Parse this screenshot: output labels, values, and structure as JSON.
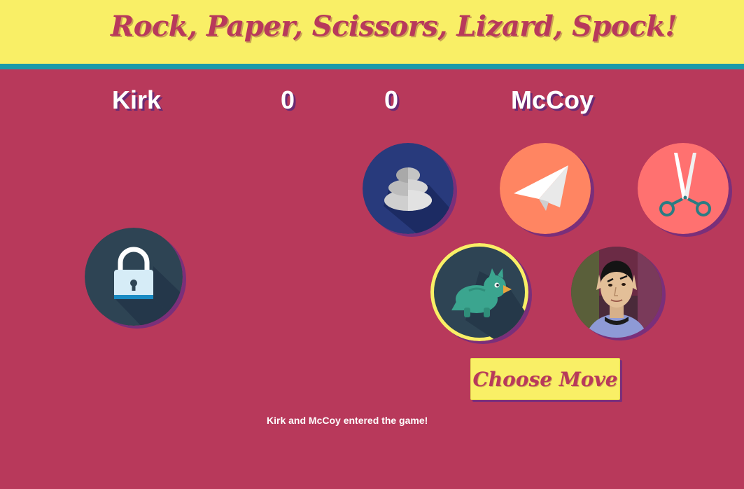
{
  "header": {
    "title": "Rock, Paper, Scissors, Lizard, Spock!"
  },
  "players": {
    "left": {
      "name": "Kirk",
      "score": "0"
    },
    "right": {
      "name": "McCoy",
      "score": "0"
    }
  },
  "moves": [
    {
      "id": "rock",
      "icon": "rock-icon",
      "color": "#283a7c"
    },
    {
      "id": "paper",
      "icon": "paper-plane-icon",
      "color": "#ff8562"
    },
    {
      "id": "scissors",
      "icon": "scissors-icon",
      "color": "#ff7170"
    },
    {
      "id": "lizard",
      "icon": "lizard-icon",
      "color": "#2e4454",
      "selected": true
    },
    {
      "id": "spock",
      "icon": "spock-portrait"
    }
  ],
  "left_move": {
    "icon": "lock-icon",
    "state": "locked"
  },
  "actions": {
    "choose_move_label": "Choose Move"
  },
  "status": {
    "message": "Kirk and McCoy entered the game!"
  },
  "colors": {
    "background": "#b8395b",
    "header": "#f9ef66",
    "stripe": "#1b9aa9",
    "shadow": "#7a2f7a"
  }
}
